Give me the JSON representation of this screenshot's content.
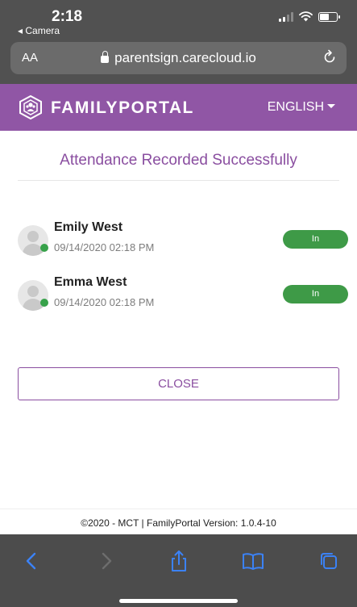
{
  "status_bar": {
    "time": "2:18",
    "back_app": "◂ Camera"
  },
  "browser": {
    "text_size": "AA",
    "url": "parentsign.carecloud.io"
  },
  "header": {
    "brand": "FAMILYPORTAL",
    "language": "ENGLISH"
  },
  "page": {
    "title": "Attendance Recorded Successfully"
  },
  "children": [
    {
      "name": "Emily West",
      "timestamp": "09/14/2020 02:18 PM",
      "status": "In",
      "online": true
    },
    {
      "name": "Emma West",
      "timestamp": "09/14/2020 02:18 PM",
      "status": "In",
      "online": true
    }
  ],
  "actions": {
    "close_label": "CLOSE"
  },
  "footer": {
    "text": "©2020  -  MCT | FamilyPortal  Version:  1.0.4-10"
  },
  "colors": {
    "brand_purple": "#9056a5",
    "title_purple": "#8a4ea0",
    "status_green": "#3e9a47",
    "safari_blue": "#3b82f6"
  },
  "icons": {
    "toolbar": [
      "back-arrow-icon",
      "forward-arrow-icon",
      "share-icon",
      "bookmarks-icon",
      "tabs-icon"
    ]
  }
}
